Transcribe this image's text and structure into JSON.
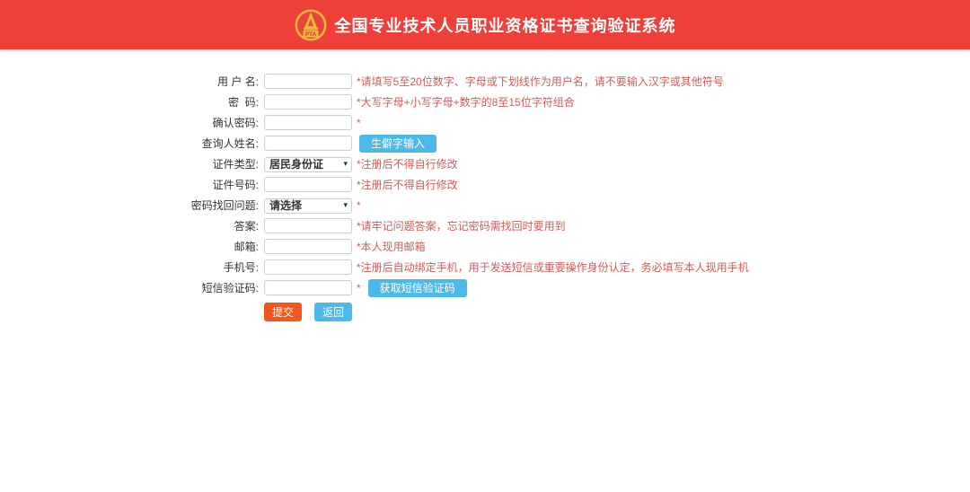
{
  "header": {
    "logo_text": "PTA",
    "title": "全国专业技术人员职业资格证书查询验证系统"
  },
  "form": {
    "rows": [
      {
        "label": "用 户 名:",
        "hint": "*请填写5至20位数字、字母或下划线作为用户名，请不要输入汉字或其他符号"
      },
      {
        "label": "密  码:",
        "hint": "*大写字母+小写字母+数字的8至15位字符组合"
      },
      {
        "label": "确认密码:",
        "hint": "*"
      },
      {
        "label": "查询人姓名:",
        "button": "生僻字输入"
      },
      {
        "label": "证件类型:",
        "value": "居民身份证",
        "hint": "*注册后不得自行修改"
      },
      {
        "label": "证件号码:",
        "hint": "*注册后不得自行修改"
      },
      {
        "label": "密码找回问题:",
        "value": "请选择",
        "hint": "*"
      },
      {
        "label": "答案:",
        "hint": "*请牢记问题答案，忘记密码需找回时要用到"
      },
      {
        "label": "邮箱:",
        "hint": "*本人现用邮箱"
      },
      {
        "label": "手机号:",
        "hint": "*注册后自动绑定手机，用于发送短信或重要操作身份认定，务必填写本人现用手机"
      },
      {
        "label": "短信验证码:",
        "hint": "*",
        "button": "获取短信验证码"
      }
    ],
    "submit_label": "提交",
    "back_label": "返回"
  },
  "colors": {
    "header_bg": "#ee3f38",
    "accent_blue": "#4cb9e8",
    "accent_orange": "#f2571f",
    "hint_red": "#cc5c5c"
  }
}
